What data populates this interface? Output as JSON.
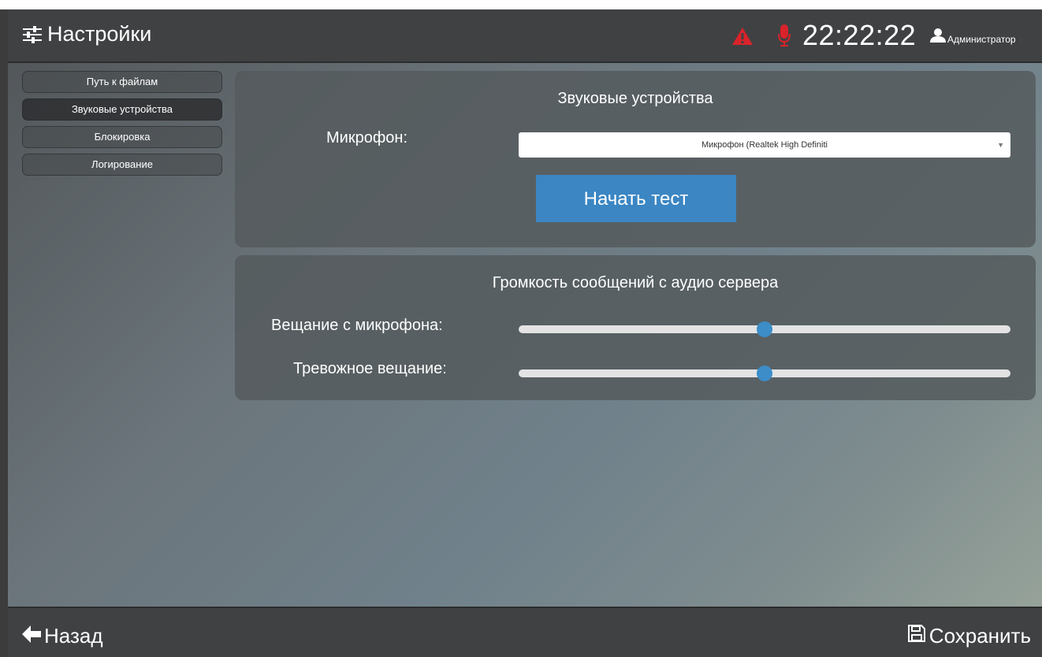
{
  "header": {
    "title": "Настройки",
    "clock": "22:22:22",
    "user": "Администратор",
    "icons": [
      "sliders-icon",
      "alert-icon",
      "microphone-icon",
      "user-icon"
    ]
  },
  "sidebar": {
    "items": [
      {
        "label": "Путь к файлам"
      },
      {
        "label": "Звуковые устройства"
      },
      {
        "label": "Блокировка"
      },
      {
        "label": "Логирование"
      }
    ]
  },
  "sound_devices": {
    "title": "Звуковые устройства",
    "mic_label": "Микрофон:",
    "mic_value": "Микрофон (Realtek High Definiti",
    "test_button": "Начать тест"
  },
  "volume": {
    "title": "Громкость сообщений с аудио сервера",
    "mic_broadcast_label": "Вещание с микрофона:",
    "mic_broadcast_level": 0.5,
    "alarm_broadcast_label": "Тревожное вещание:",
    "alarm_broadcast_level": 0.5
  },
  "footer": {
    "back_label": "Назад",
    "save_label": "Сохранить"
  },
  "colors": {
    "accent": "#3b86c3",
    "alert": "#d9232a",
    "bar": "#3f4143"
  }
}
